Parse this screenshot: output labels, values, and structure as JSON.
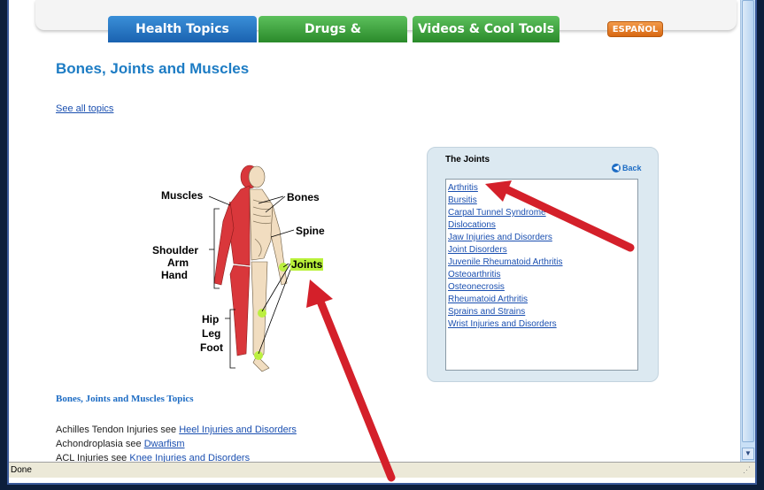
{
  "nav": {
    "tabs": [
      {
        "label": "Health Topics"
      },
      {
        "label": "Drugs & Supplements"
      },
      {
        "label": "Videos & Cool Tools"
      }
    ],
    "language_button": "ESPAÑOL"
  },
  "page": {
    "title": "Bones, Joints and Muscles",
    "see_all": "See all topics"
  },
  "diagram": {
    "labels": {
      "muscles": "Muscles",
      "bones": "Bones",
      "spine": "Spine",
      "shoulder": "Shoulder",
      "arm": "Arm",
      "hand": "Hand",
      "joints": "Joints",
      "hip": "Hip",
      "leg": "Leg",
      "foot": "Foot"
    }
  },
  "panel": {
    "title": "The Joints",
    "back_label": "Back",
    "items": [
      "Arthritis",
      "Bursitis",
      "Carpal Tunnel Syndrome",
      "Dislocations",
      "Jaw Injuries and Disorders",
      "Joint Disorders",
      "Juvenile Rheumatoid Arthritis",
      "Osteoarthritis",
      "Osteonecrosis",
      "Rheumatoid Arthritis",
      "Sprains and Strains",
      "Wrist Injuries and Disorders"
    ]
  },
  "topics": {
    "heading": "Bones, Joints and Muscles Topics",
    "rows": [
      {
        "text": "Achilles Tendon Injuries see ",
        "link": "Heel Injuries and Disorders"
      },
      {
        "text": "Achondroplasia see ",
        "link": "Dwarfism"
      },
      {
        "text": "ACL Injuries see ",
        "link": "Knee Injuries and Disorders"
      }
    ]
  },
  "status": {
    "text": "Done"
  },
  "colors": {
    "accent": "#1d7cc4",
    "arrow": "#d4202a",
    "joint_highlight": "#b9f13a"
  }
}
